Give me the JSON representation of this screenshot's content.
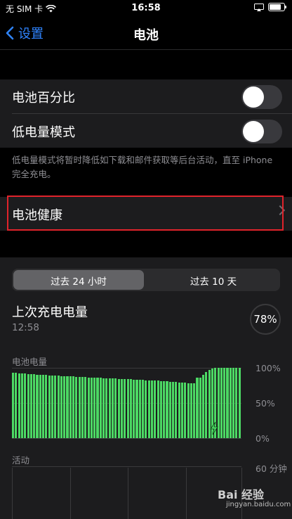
{
  "status": {
    "carrier": "无 SIM 卡",
    "time": "16:58",
    "battery_level": 0.78
  },
  "nav": {
    "back_label": "设置",
    "title": "电池"
  },
  "settings": {
    "battery_percentage_label": "电池百分比",
    "battery_percentage_on": false,
    "low_power_label": "低电量模式",
    "low_power_on": false,
    "low_power_note": "低电量模式将暂时降低如下载和邮件获取等后台活动，直至 iPhone 完全充电。",
    "battery_health_label": "电池健康"
  },
  "usage": {
    "tabs": [
      "过去 24 小时",
      "过去 10 天"
    ],
    "selected_tab": 0,
    "last_charge_title": "上次充电电量",
    "last_charge_time": "12:58",
    "last_charge_percent": "78%"
  },
  "chart_data": {
    "type": "bar",
    "title": "电池电量",
    "y_ticks": [
      "100%",
      "50%",
      "0%"
    ],
    "ylim": [
      0,
      100
    ],
    "values": [
      93,
      93,
      92,
      92,
      92,
      91,
      91,
      91,
      90,
      90,
      90,
      90,
      89,
      89,
      89,
      89,
      88,
      88,
      88,
      88,
      88,
      87,
      87,
      87,
      87,
      86,
      86,
      86,
      86,
      86,
      85,
      85,
      85,
      85,
      85,
      84,
      84,
      84,
      84,
      84,
      83,
      83,
      83,
      83,
      82,
      82,
      82,
      82,
      82,
      81,
      81,
      81,
      80,
      80,
      80,
      79,
      79,
      79,
      78,
      78,
      78,
      86,
      86,
      90,
      94,
      97,
      99,
      100,
      100,
      100,
      100,
      100,
      100,
      100,
      100,
      100
    ],
    "charging_marker": true,
    "activity_label": "活动",
    "activity_tick": "60 分钟"
  },
  "watermark": {
    "brand": "Bai 经验",
    "url": "jingyan.baidu.com"
  },
  "colors": {
    "accent": "#2f84ff",
    "battery_green": "#4cd964",
    "highlight_red": "#e0232b"
  }
}
